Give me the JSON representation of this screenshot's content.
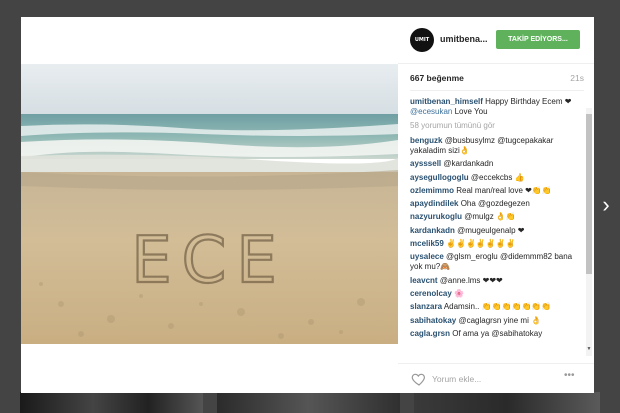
{
  "post": {
    "username": "umitbena...",
    "follow_label": "TAKİP EDİYORS...",
    "likes": "667 beğenme",
    "time": "21s",
    "caption": {
      "user": "umitbenan_himself",
      "text": " Happy Birthday Ecem ❤ ",
      "tag": "@ecesukan",
      "suffix": " Love You"
    },
    "view_all": "58 yorumun tümünü gör",
    "comments": [
      {
        "user": "benguzk",
        "text": "@busbusylmz @tugcepakakar yakaladim sizi👌"
      },
      {
        "user": "aysssell",
        "text": "@kardankadn"
      },
      {
        "user": "aysegullogoglu",
        "text": "@eccekcbs 👍"
      },
      {
        "user": "ozlemimmo",
        "text": "Real man/real love ❤👏👏"
      },
      {
        "user": "apaydindilek",
        "text": "Oha @gozdegezen"
      },
      {
        "user": "nazyurukoglu",
        "text": "@mulgz 👌👏"
      },
      {
        "user": "kardankadn",
        "text": "@mugeulgenalp ❤"
      },
      {
        "user": "mcelik59",
        "text": "✌✌✌✌✌✌✌"
      },
      {
        "user": "uysalece",
        "text": "@glsm_eroglu @didemmm82 bana yok mu?🙈"
      },
      {
        "user": "leavcnt",
        "text": "@anne.lms ❤❤❤"
      },
      {
        "user": "cerenolcay",
        "text": "🌸"
      },
      {
        "user": "slanzara",
        "text": "Adamsin.. 👏👏👏👏👏👏👏"
      },
      {
        "user": "sabihatokay",
        "text": "@caglagrsn yine mi 👌"
      },
      {
        "user": "cagla.grsn",
        "text": "Of ama ya @sabihatokay"
      }
    ],
    "comment_placeholder": "Yorum ekle...",
    "more_label": "•••",
    "sand_text": "ECE"
  },
  "nav": {
    "next_arrow": "›"
  },
  "colors": {
    "follow_green": "#5fb25b",
    "username_blue": "#2a5171"
  }
}
